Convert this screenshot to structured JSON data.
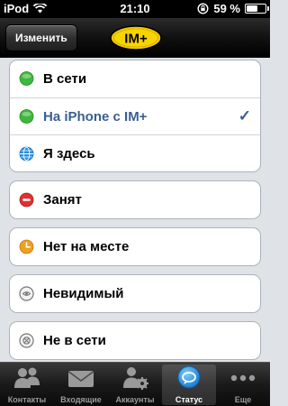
{
  "status_bar": {
    "carrier": "iPod",
    "time": "21:10",
    "battery_percent": "59 %",
    "battery_level": 0.59
  },
  "nav": {
    "edit_label": "Изменить",
    "logo_text": "IM+"
  },
  "statuses": [
    {
      "label": "В сети",
      "icon": "online-chat-bubble-icon",
      "color": "#3db83d",
      "selected": false
    },
    {
      "label": "На iPhone с IM+",
      "icon": "mobile-chat-bubble-icon",
      "color": "#3db83d",
      "selected": true
    },
    {
      "label": "Я здесь",
      "icon": "globe-icon",
      "color": "#2a8fe0",
      "selected": false
    },
    {
      "label": "Занят",
      "icon": "busy-minus-icon",
      "color": "#e03030"
    },
    {
      "label": "Нет на месте",
      "icon": "away-clock-icon",
      "color": "#f0a020"
    },
    {
      "label": "Невидимый",
      "icon": "invisible-icon",
      "color": "#888888"
    },
    {
      "label": "Не в сети",
      "icon": "offline-icon",
      "color": "#888888"
    }
  ],
  "check_mark": "✓",
  "tabs": [
    {
      "label": "Контакты",
      "icon": "contacts-icon",
      "active": false
    },
    {
      "label": "Входящие",
      "icon": "inbox-envelope-icon",
      "active": false
    },
    {
      "label": "Аккаунты",
      "icon": "accounts-gear-icon",
      "active": false
    },
    {
      "label": "Статус",
      "icon": "status-bubble-icon",
      "active": true
    },
    {
      "label": "Еще",
      "icon": "more-dots-icon",
      "active": false
    }
  ]
}
